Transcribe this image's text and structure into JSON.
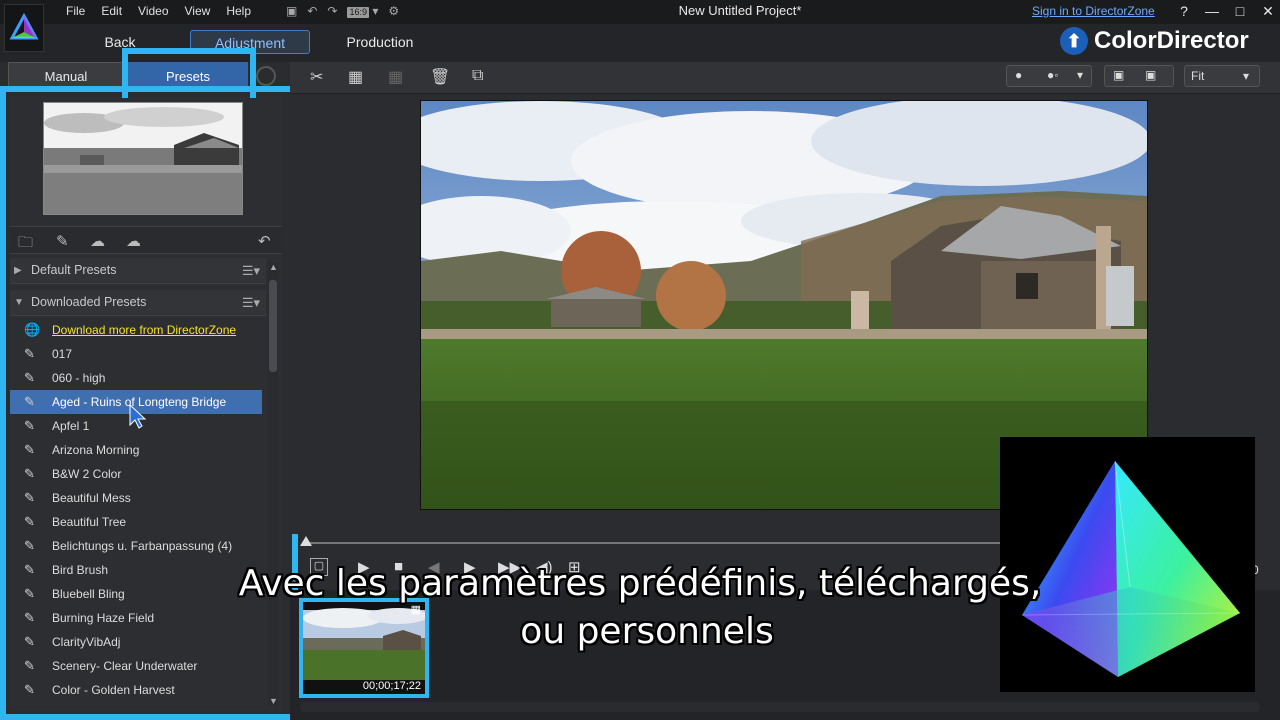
{
  "window": {
    "title": "New Untitled Project*",
    "menu": [
      "File",
      "Edit",
      "Video",
      "View",
      "Help"
    ],
    "aspect_ratio": "16:9",
    "sign_in": "Sign in to DirectorZone",
    "help": "?",
    "minimize": "—",
    "maximize": "□",
    "close": "✕"
  },
  "modes": {
    "back": "Back",
    "adjustment": "Adjustment",
    "production": "Production"
  },
  "brand": {
    "name": "ColorDirector"
  },
  "left_panel": {
    "tabs": {
      "manual": "Manual",
      "presets": "Presets"
    },
    "groups": [
      {
        "label": "Default Presets",
        "expanded": false
      },
      {
        "label": "Downloaded Presets",
        "expanded": true
      }
    ],
    "download_link": "Download more from DirectorZone",
    "presets": [
      {
        "label": "017"
      },
      {
        "label": "060 - high"
      },
      {
        "label": "Aged - Ruins of Longteng Bridge",
        "selected": true
      },
      {
        "label": "Apfel 1"
      },
      {
        "label": "Arizona Morning"
      },
      {
        "label": "B&W 2 Color"
      },
      {
        "label": "Beautiful Mess"
      },
      {
        "label": "Beautiful Tree"
      },
      {
        "label": "Belichtungs u. Farbanpassung (4)"
      },
      {
        "label": "Bird Brush"
      },
      {
        "label": "Bluebell Bling"
      },
      {
        "label": "Burning Haze Field"
      },
      {
        "label": "ClarityVibAdj"
      },
      {
        "label": "Scenery- Clear Underwater"
      },
      {
        "label": "Color - Golden Harvest"
      }
    ]
  },
  "viewer": {
    "fit": "Fit"
  },
  "timeline": {
    "clip_timecode": "00;00;17;22",
    "right_readout": "0"
  },
  "subtitles": {
    "line1": "Avec les paramètres prédéfinis, téléchargés,",
    "line2": "ou personnels"
  },
  "colors": {
    "highlight": "#2fb5f0",
    "accent": "#3366a8",
    "link": "#f4e332",
    "signin": "#6fa9ff"
  }
}
